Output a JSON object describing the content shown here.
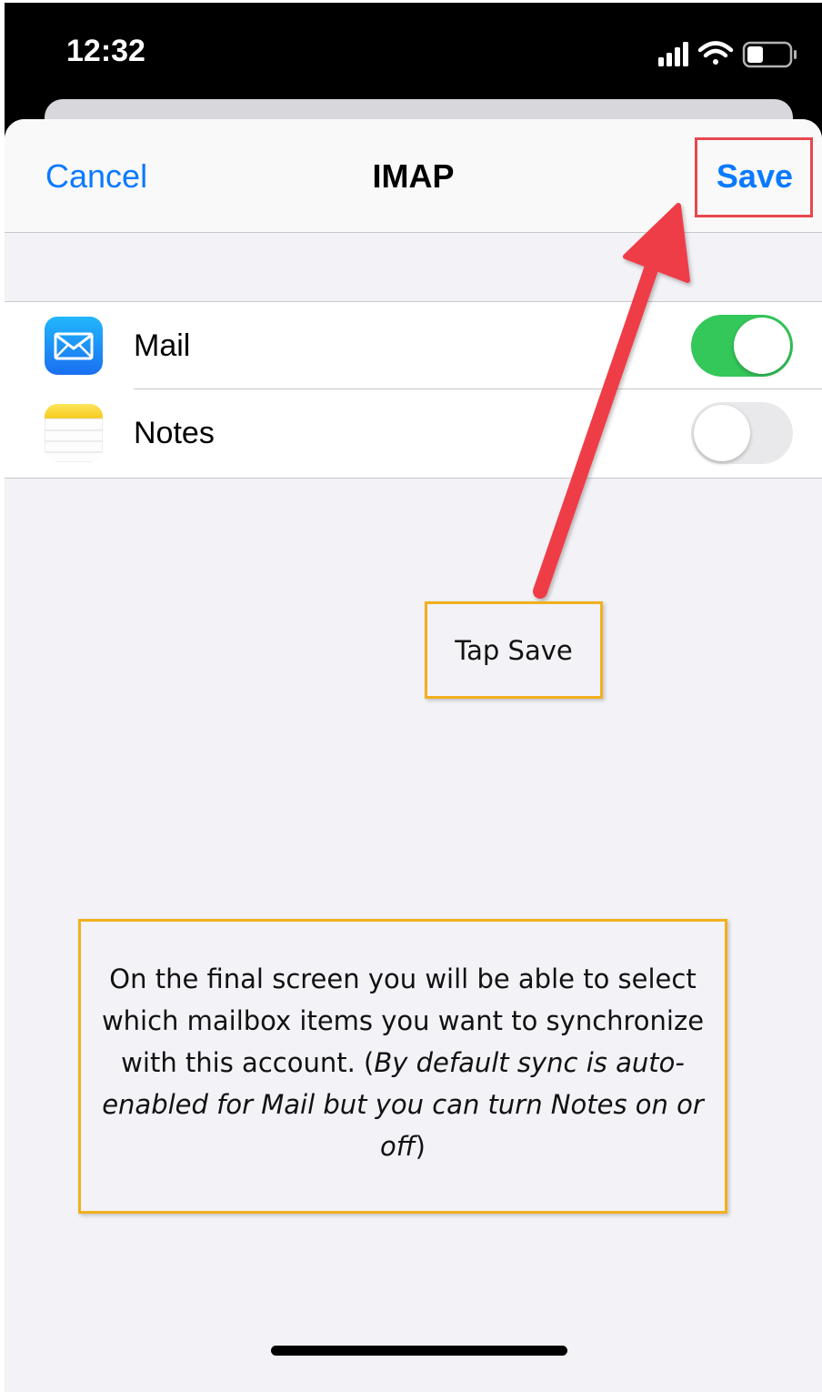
{
  "status_bar": {
    "time": "12:32",
    "icons": [
      "signal-icon",
      "wifi-icon",
      "battery-icon"
    ]
  },
  "navbar": {
    "cancel_label": "Cancel",
    "title": "IMAP",
    "save_label": "Save"
  },
  "list": {
    "items": [
      {
        "label": "Mail",
        "icon": "mail-app-icon",
        "enabled": true
      },
      {
        "label": "Notes",
        "icon": "notes-app-icon",
        "enabled": false
      }
    ]
  },
  "annotations": {
    "tap_save": "Tap Save",
    "info_text_normal": "On the final screen you will be able to select which mailbox items you want to synchronize with this account. (",
    "info_text_italic": "By default sync is auto-enabled for Mail but you can turn Notes on or off",
    "info_text_end": ")"
  },
  "colors": {
    "accent": "#0a7aff",
    "toggle_on": "#34c759",
    "callout_red": "#e8474e",
    "callout_orange": "#f2b01e",
    "arrow_red": "#ef3d47"
  }
}
